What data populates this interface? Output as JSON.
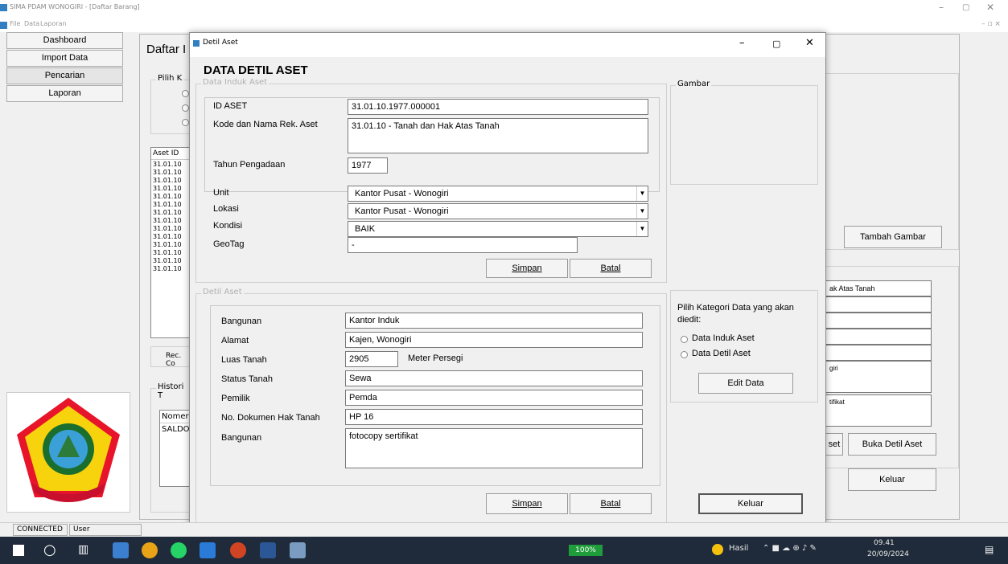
{
  "app": {
    "title": "SIMA PDAM WONOGIRI - [Daftar Barang]",
    "menu": [
      "File",
      "Data",
      "Laporan"
    ]
  },
  "nav": [
    "Dashboard",
    "Import Data",
    "Pencarian",
    "Laporan"
  ],
  "bg_form": {
    "title": "Daftar I",
    "pilih_group": "Pilih K",
    "aset_col": "Aset ID",
    "aset_rows": [
      "31.01.10",
      "31.01.10",
      "31.01.10",
      "31.01.10",
      "31.01.10",
      "31.01.10",
      "31.01.10",
      "31.01.10",
      "31.01.10",
      "31.01.10",
      "31.01.10",
      "31.01.10",
      "31.01.10",
      "31.01.10"
    ],
    "rec_label": "Rec. Co",
    "histori_group": "Histori T",
    "hist_col": "Nomer",
    "hist_row": "SALDO",
    "right_fields": [
      "ak Atas Tanah",
      "",
      "",
      "",
      "",
      "giri",
      "tifikat"
    ],
    "tambah_gambar": "Tambah Gambar",
    "set_btn": "set",
    "buka_detil": "Buka Detil Aset",
    "keluar": "Keluar"
  },
  "dialog": {
    "window_title": "Detil Aset",
    "heading": "DATA DETIL ASET",
    "induk_group": "Data Induk Aset",
    "fields": {
      "id_aset_label": "ID ASET",
      "id_aset_value": "31.01.10.1977.000001",
      "kode_label": "Kode dan Nama Rek. Aset",
      "kode_value": "31.01.10 - Tanah dan Hak Atas Tanah",
      "tahun_label": "Tahun Pengadaan",
      "tahun_value": "1977",
      "unit_label": "Unit",
      "unit_value": "Kantor Pusat - Wonogiri",
      "lokasi_label": "Lokasi",
      "lokasi_value": "Kantor Pusat - Wonogiri",
      "kondisi_label": "Kondisi",
      "kondisi_value": "BAIK",
      "geotag_label": "GeoTag",
      "geotag_value": "-"
    },
    "simpan": "Simpan",
    "batal": "Batal",
    "detil_group": "Detil Aset",
    "detil": {
      "bangunan_label": "Bangunan",
      "bangunan_value": "Kantor Induk",
      "alamat_label": "Alamat",
      "alamat_value": "Kajen, Wonogiri",
      "luas_label": "Luas Tanah",
      "luas_value": "2905",
      "luas_unit": "Meter Persegi",
      "status_label": "Status Tanah",
      "status_value": "Sewa",
      "pemilik_label": "Pemilik",
      "pemilik_value": "Pemda",
      "nodok_label": "No. Dokumen Hak Tanah",
      "nodok_value": "HP 16",
      "bangunan2_label": "Bangunan",
      "bangunan2_value": "fotocopy sertifikat"
    },
    "simpan2": "Simpan",
    "batal2": "Batal",
    "gambar_group": "Gambar",
    "kategori_text": "Pilih Kategori Data yang akan diedit:",
    "radio_induk": "Data Induk Aset",
    "radio_detil": "Data Detil Aset",
    "edit_data": "Edit Data",
    "keluar": "Keluar"
  },
  "statusbar": {
    "connected": "CONNECTED",
    "user": "User"
  },
  "taskbar": {
    "progress": "100%",
    "weather": "Hasil",
    "time": "09.41",
    "date": "20/09/2024"
  }
}
